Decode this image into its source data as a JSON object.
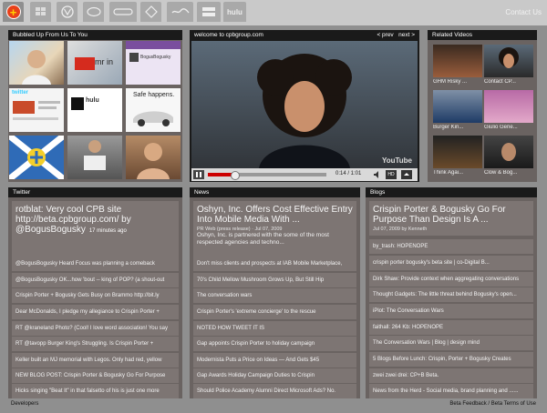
{
  "tabs": [
    {
      "icon": "cpb-plus-icon",
      "label": "+"
    },
    {
      "icon": "windows-logo-icon",
      "label": ""
    },
    {
      "icon": "volkswagen-logo-icon",
      "label": "VW"
    },
    {
      "icon": "ford-logo-icon",
      "label": ""
    },
    {
      "icon": "dominos-logo-icon",
      "label": ""
    },
    {
      "icon": "burger-king-logo-icon",
      "label": ""
    },
    {
      "icon": "coca-cola-logo-icon",
      "label": ""
    },
    {
      "icon": "guitar-hero-logo-icon",
      "label": ""
    },
    {
      "icon": "hulu-logo-icon",
      "label": "hulu"
    }
  ],
  "header": {
    "contact": "Contact Us"
  },
  "bubbled": {
    "title": "Bubbled Up From Us To You",
    "tile_texts": [
      "mr in",
      "BogusBogusky",
      "twitter",
      "hulu",
      "Safe happens.",
      "twitter",
      ""
    ]
  },
  "video": {
    "title": "welcome to cpbgroup.com",
    "prev": "< prev",
    "next": "next >",
    "time": "0:14 / 1:01",
    "hd": "HD",
    "watermark": "YouTube",
    "progress": 0.23
  },
  "related": {
    "title": "Related Videos",
    "items": [
      {
        "label": "GHM Risky ..."
      },
      {
        "label": "Contact CP..."
      },
      {
        "label": "Burger Kin..."
      },
      {
        "label": "Giulio Gene..."
      },
      {
        "label": "Think Agai..."
      },
      {
        "label": "Clow & Bog..."
      }
    ]
  },
  "twitter": {
    "title": "Twitter",
    "featured": {
      "text": "rotblat: Very cool CPB site http://beta.cpbgroup.com/ by @BogusBogusky",
      "time": "17 minutes ago"
    },
    "items": [
      "@BogusBogusky Heard Focus was planning a comeback",
      "@BogusBogusky OK...how 'bout -- king of POP? (a shout-out",
      "Crispin Porter + Bogusky Gets Busy on Brammo http://bit.ly",
      "Dear McDonalds, I pledge my allegiance to Crispin Porter +",
      "RT @kraneland Photo? (Cool! I love word association! You say",
      "RT @tavopp Burger King's Struggling. Is Crispin Porter +",
      "Keller built an MJ memorial with Legos. Only had red, yellow",
      "NEW BLOG POST: Crispin Porter & Bogusky Go For Purpose",
      "Hicks singing \"Beat It\" in that falsetto of his is just one more"
    ]
  },
  "news": {
    "title": "News",
    "featured": {
      "title": "Oshyn, Inc. Offers Cost Effective Entry Into Mobile Media With ...",
      "meta": "PR Web (press release) · Jul 07, 2009",
      "body": "Oshyn, Inc. is partnered with the some of the most respected agencies and techno..."
    },
    "items": [
      "Don't miss clients and prospects at IAB Mobile Marketplace,",
      "70's Child Mellow Mushroom Grows Up, But Still Hip",
      "The conversation wars",
      "Crispin Porter's 'extreme concierge' to the rescue",
      "NOTED HOW TWEET IT IS",
      "Gap appoints Crispin Porter to holiday campaign",
      "Modernista Puts a Price on Ideas — And Gets $45",
      "Gap Awards Holiday Campaign Duties to Crispin",
      "Should Police Academy Alumni Direct Microsoft Ads? No."
    ]
  },
  "blogs": {
    "title": "Blogs",
    "featured": {
      "title": "Crispin Porter & Bogusky Go For Purpose Than Design Is A ...",
      "meta": "Jul 07, 2009 by Kenneth"
    },
    "items": [
      "by_trash: HOPENOPE",
      "crispin porter bogusky's beta site | co-Digital B...",
      "Dirk Shaw: Provide context when aggregating conversations",
      "Thought Gadgets: The little threat behind Bogusky's open...",
      "iPlot: The Conversation Wars",
      "faithall: 264 Kb: HOPENOPE",
      "The Conversation Wars | Blog | design mind",
      "5 Blogs Before Lunch: Crispin, Porter + Bogusky Creates",
      "zwei zwei drei: CP+B Beta.",
      "News from the Herd - Social media, brand planning and ......"
    ]
  },
  "footer": {
    "left": "Developers",
    "right": "Beta Feedback / Beta Terms of Use"
  }
}
